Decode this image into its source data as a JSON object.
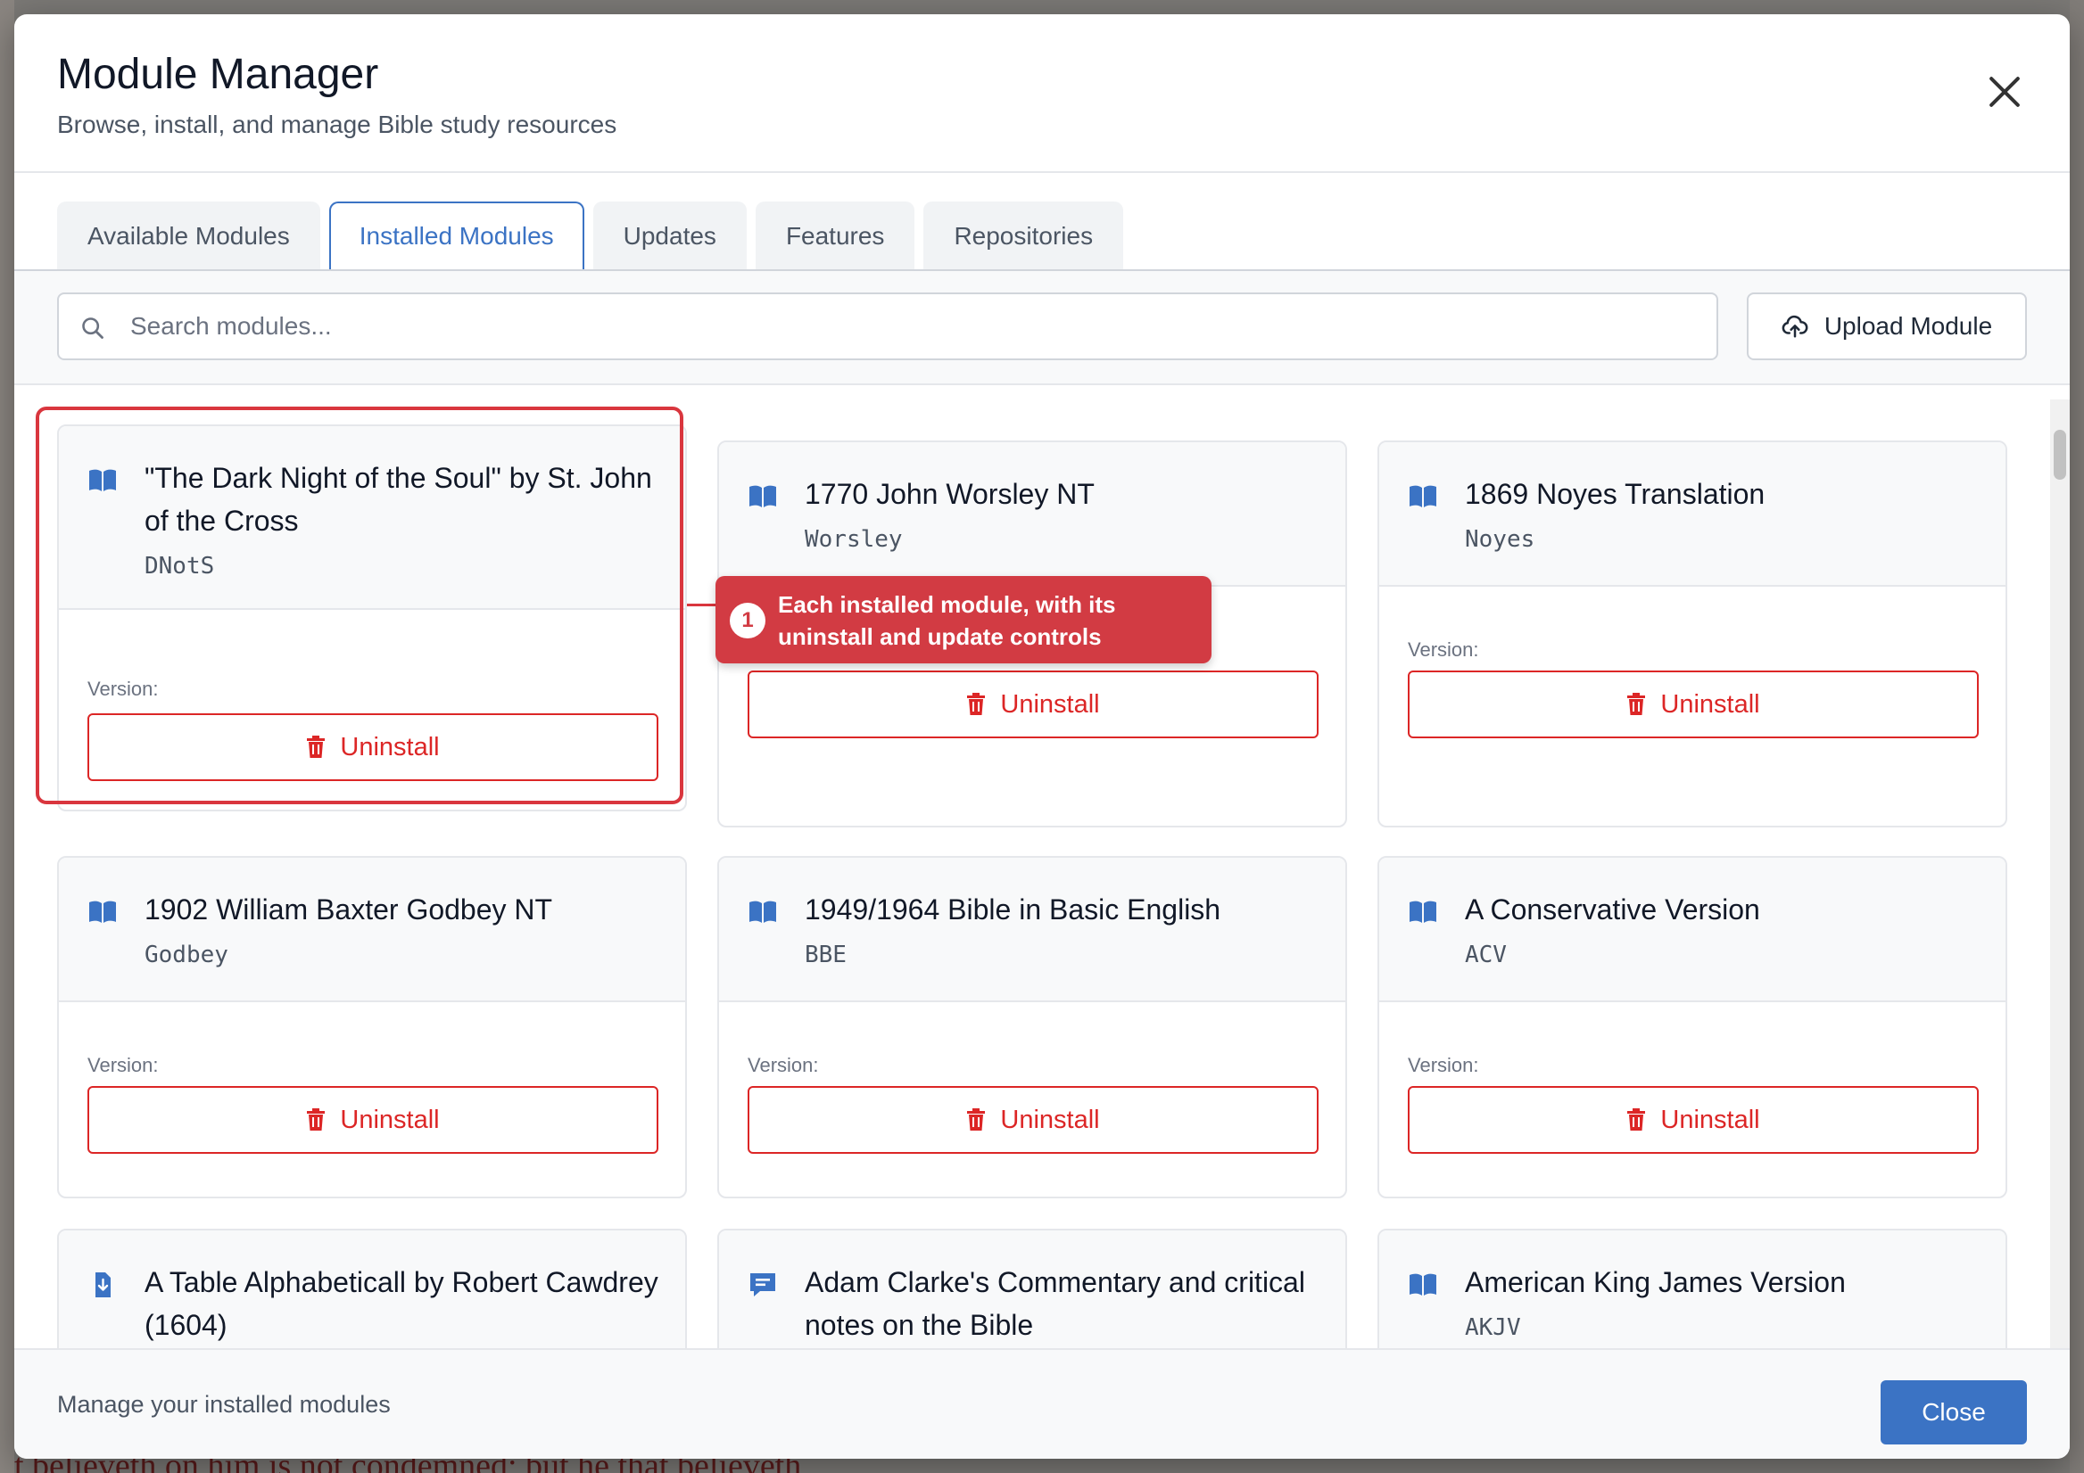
{
  "background": {
    "bottom_text": "t believeth on him is not condemned: but he that believeth"
  },
  "modal": {
    "title": "Module Manager",
    "subtitle": "Browse, install, and manage Bible study resources"
  },
  "tabs": [
    {
      "label": "Available Modules",
      "active": false
    },
    {
      "label": "Installed Modules",
      "active": true
    },
    {
      "label": "Updates",
      "active": false
    },
    {
      "label": "Features",
      "active": false
    },
    {
      "label": "Repositories",
      "active": false
    }
  ],
  "toolbar": {
    "search_placeholder": "Search modules...",
    "upload_label": "Upload Module"
  },
  "version_label": "Version:",
  "uninstall_label": "Uninstall",
  "modules": [
    {
      "title": "\"The Dark Night of the Soul\" by St. John of the Cross",
      "code": "DNotS",
      "icon": "book-open-icon"
    },
    {
      "title": "1770 John Worsley NT",
      "code": "Worsley",
      "icon": "book-open-icon"
    },
    {
      "title": "1869 Noyes Translation",
      "code": "Noyes",
      "icon": "book-open-icon"
    },
    {
      "title": "1902 William Baxter Godbey NT",
      "code": "Godbey",
      "icon": "book-open-icon"
    },
    {
      "title": "1949/1964 Bible in Basic English",
      "code": "BBE",
      "icon": "book-open-icon"
    },
    {
      "title": "A Conservative Version",
      "code": "ACV",
      "icon": "book-open-icon"
    },
    {
      "title": "A Table Alphabeticall by Robert Cawdrey (1604)",
      "code": "",
      "icon": "download-file-icon"
    },
    {
      "title": "Adam Clarke's Commentary and critical notes on the Bible",
      "code": "",
      "icon": "comment-icon"
    },
    {
      "title": "American King James Version",
      "code": "AKJV",
      "icon": "book-open-icon"
    }
  ],
  "callout": {
    "number": "1",
    "text": "Each installed module, with its uninstall and update controls"
  },
  "footer": {
    "text": "Manage your installed modules",
    "close_label": "Close"
  },
  "colors": {
    "accent": "#3b73c4",
    "danger": "#dc2626",
    "callout": "#d23b43"
  }
}
